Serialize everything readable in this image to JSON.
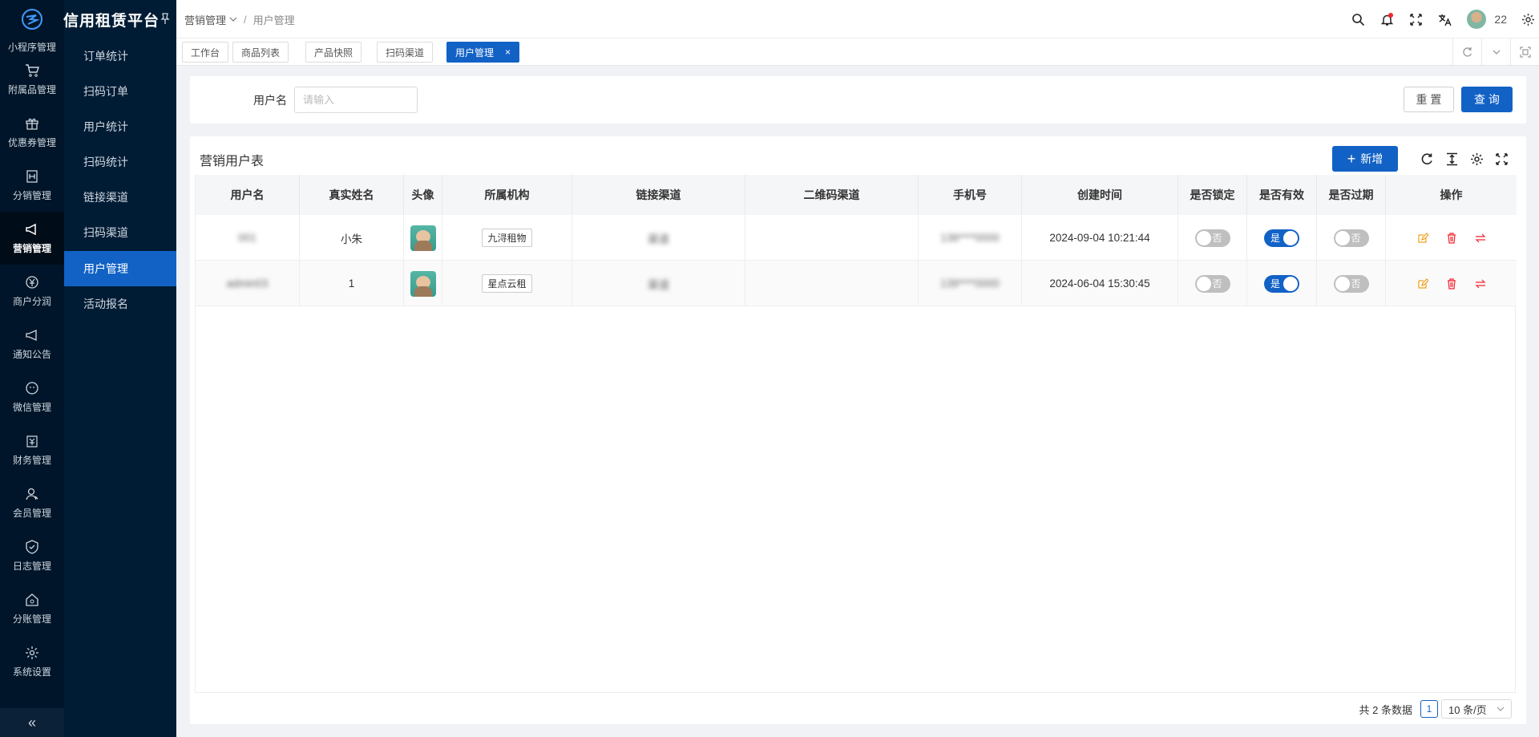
{
  "sidebar": {
    "first_item": "小程序管理",
    "items": [
      {
        "label": "附属品管理",
        "icon": "cart-icon"
      },
      {
        "label": "优惠券管理",
        "icon": "gift-icon"
      },
      {
        "label": "分销管理",
        "icon": "share-icon"
      },
      {
        "label": "营销管理",
        "icon": "megaphone-icon",
        "active": true
      },
      {
        "label": "商户分润",
        "icon": "yen-icon"
      },
      {
        "label": "通知公告",
        "icon": "notice-icon"
      },
      {
        "label": "微信管理",
        "icon": "wechat-icon"
      },
      {
        "label": "财务管理",
        "icon": "finance-icon"
      },
      {
        "label": "会员管理",
        "icon": "member-icon"
      },
      {
        "label": "日志管理",
        "icon": "shield-icon"
      },
      {
        "label": "分账管理",
        "icon": "split-icon"
      },
      {
        "label": "系统设置",
        "icon": "gear-icon"
      }
    ],
    "collapse_glyph": "«"
  },
  "brand": {
    "title": "信用租赁平台"
  },
  "submenu": {
    "items": [
      {
        "label": "订单统计"
      },
      {
        "label": "扫码订单"
      },
      {
        "label": "用户统计"
      },
      {
        "label": "扫码统计"
      },
      {
        "label": "链接渠道"
      },
      {
        "label": "扫码渠道"
      },
      {
        "label": "用户管理",
        "active": true
      },
      {
        "label": "活动报名"
      }
    ]
  },
  "breadcrumb": {
    "parent": "营销管理",
    "current": "用户管理",
    "sep": "/"
  },
  "header": {
    "username": "22"
  },
  "tabs": [
    {
      "label": "工作台"
    },
    {
      "label": "商品列表"
    },
    {
      "label": "产品快照"
    },
    {
      "label": "扫码渠道"
    },
    {
      "label": "用户管理",
      "active": true,
      "close": "×"
    }
  ],
  "filter": {
    "label": "用户名",
    "placeholder": "请输入",
    "reset": "重 置",
    "query": "查 询"
  },
  "table_card": {
    "title": "营销用户表",
    "add_button": "新增",
    "add_plus": "+"
  },
  "table": {
    "columns": [
      "用户名",
      "真实姓名",
      "头像",
      "所属机构",
      "链接渠道",
      "二维码渠道",
      "手机号",
      "创建时间",
      "是否锁定",
      "是否有效",
      "是否过期",
      "操作"
    ],
    "rows": [
      {
        "username": "001",
        "realname": "小朱",
        "org": "九浔租物",
        "link_channel": "渠道",
        "qr_channel": "",
        "phone": "138****0000",
        "created": "2024-09-04 10:21:44",
        "locked": {
          "on": false,
          "text": "否"
        },
        "valid": {
          "on": true,
          "text": "是"
        },
        "expired": {
          "on": false,
          "text": "否"
        }
      },
      {
        "username": "admin03",
        "realname": "1",
        "org": "星点云租",
        "link_channel": "渠道",
        "qr_channel": "",
        "phone": "139****0000",
        "created": "2024-06-04 15:30:45",
        "locked": {
          "on": false,
          "text": "否"
        },
        "valid": {
          "on": true,
          "text": "是"
        },
        "expired": {
          "on": false,
          "text": "否"
        }
      }
    ]
  },
  "pagination": {
    "total_text": "共 2 条数据",
    "current_page": "1",
    "page_size": "10 条/页"
  },
  "colors": {
    "primary": "#1262c6",
    "sidebar_bg": "#001529",
    "danger": "#f5222d",
    "edit": "#f0a020"
  }
}
